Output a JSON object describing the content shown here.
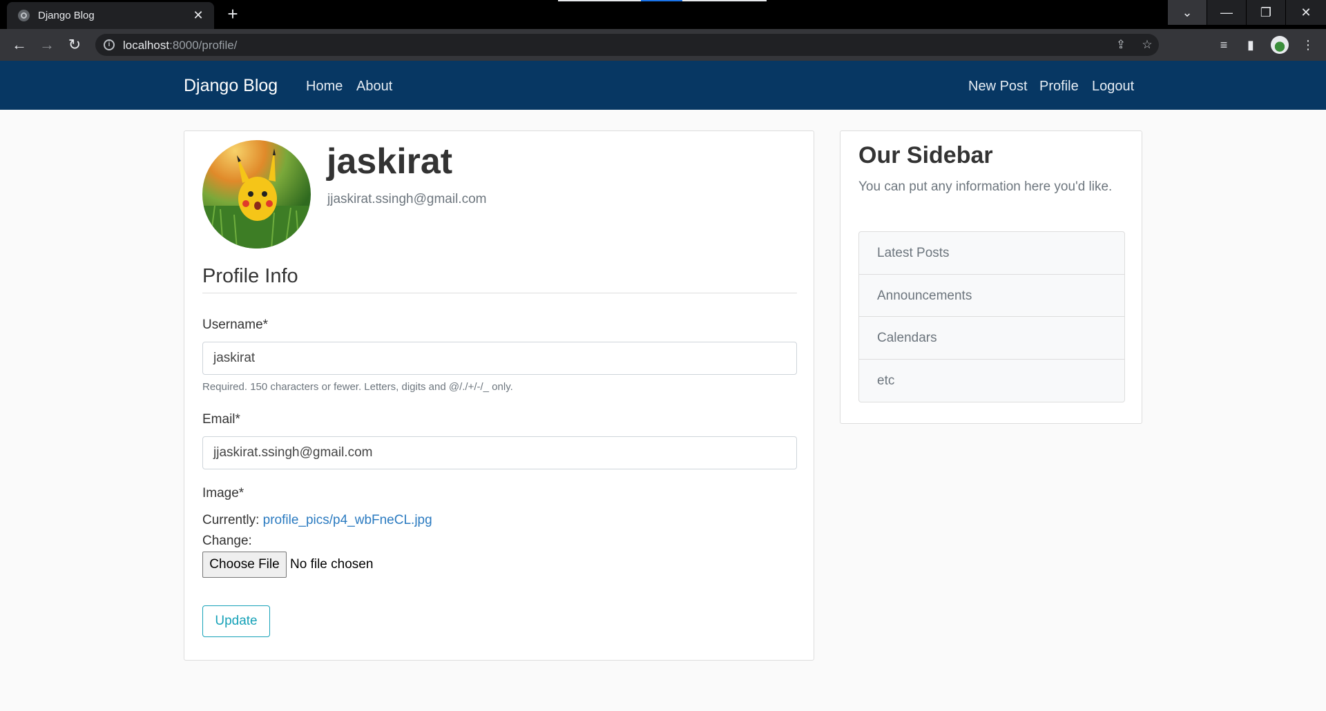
{
  "browser": {
    "tab_title": "Django Blog",
    "tab_close": "✕",
    "new_tab": "+",
    "url_host": "localhost",
    "url_rest": ":8000/profile/"
  },
  "navbar": {
    "brand": "Django Blog",
    "left_links": [
      "Home",
      "About"
    ],
    "right_links": [
      "New Post",
      "Profile",
      "Logout"
    ]
  },
  "profile": {
    "username": "jaskirat",
    "email": "jjaskirat.ssingh@gmail.com"
  },
  "form": {
    "legend": "Profile Info",
    "username_label": "Username*",
    "username_value": "jaskirat",
    "username_help": "Required. 150 characters or fewer. Letters, digits and @/./+/-/_ only.",
    "email_label": "Email*",
    "email_value": "jjaskirat.ssingh@gmail.com",
    "image_label": "Image*",
    "currently_label": "Currently:",
    "current_file": "profile_pics/p4_wbFneCL.jpg",
    "change_label": "Change:",
    "choose_file": "Choose File",
    "no_file": "No file chosen",
    "submit": "Update"
  },
  "sidebar": {
    "title": "Our Sidebar",
    "text": "You can put any information here you'd like.",
    "items": [
      "Latest Posts",
      "Announcements",
      "Calendars",
      "etc"
    ]
  },
  "colors": {
    "navbar": "#073763",
    "accent": "#17a2b8",
    "link": "#2a7ac0"
  }
}
